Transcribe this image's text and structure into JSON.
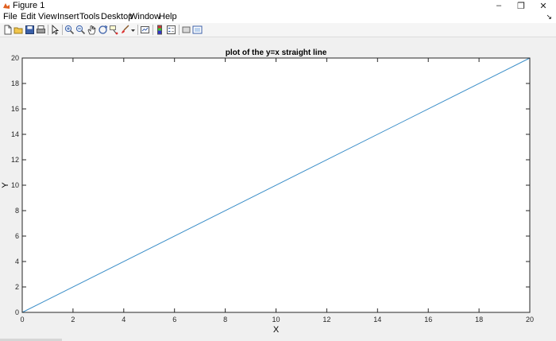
{
  "window": {
    "title": "Figure 1",
    "minimize_glyph": "–",
    "restore_glyph": "❐",
    "close_glyph": "✕"
  },
  "menu": {
    "items": [
      "File",
      "Edit",
      "View",
      "Insert",
      "Tools",
      "Desktop",
      "Window",
      "Help"
    ],
    "dock_glyph": "↘"
  },
  "toolbar": {
    "buttons": [
      "new-figure-icon",
      "open-file-icon",
      "save-icon",
      "print-icon",
      "edit-plot-icon",
      "zoom-in-icon",
      "zoom-out-icon",
      "pan-icon",
      "rotate-3d-icon",
      "data-cursor-icon",
      "brush-icon",
      "brush-dropdown-icon",
      "link-plot-icon",
      "colorbar-icon",
      "legend-icon",
      "hide-plot-tools-icon",
      "show-plot-tools-icon"
    ]
  },
  "colors": {
    "line": "#3b8ec8",
    "axes": "#262626",
    "background": "#ffffff",
    "figure": "#f0f0f0"
  },
  "chart_data": {
    "type": "line",
    "title": "plot of the y=x straight line",
    "xlabel": "X",
    "ylabel": "Y",
    "xlim": [
      0,
      20
    ],
    "ylim": [
      0,
      20
    ],
    "xticks": [
      0,
      2,
      4,
      6,
      8,
      10,
      12,
      14,
      16,
      18,
      20
    ],
    "yticks": [
      0,
      2,
      4,
      6,
      8,
      10,
      12,
      14,
      16,
      18,
      20
    ],
    "grid": false,
    "series": [
      {
        "x": [
          0,
          20
        ],
        "y": [
          0,
          20
        ]
      }
    ]
  }
}
